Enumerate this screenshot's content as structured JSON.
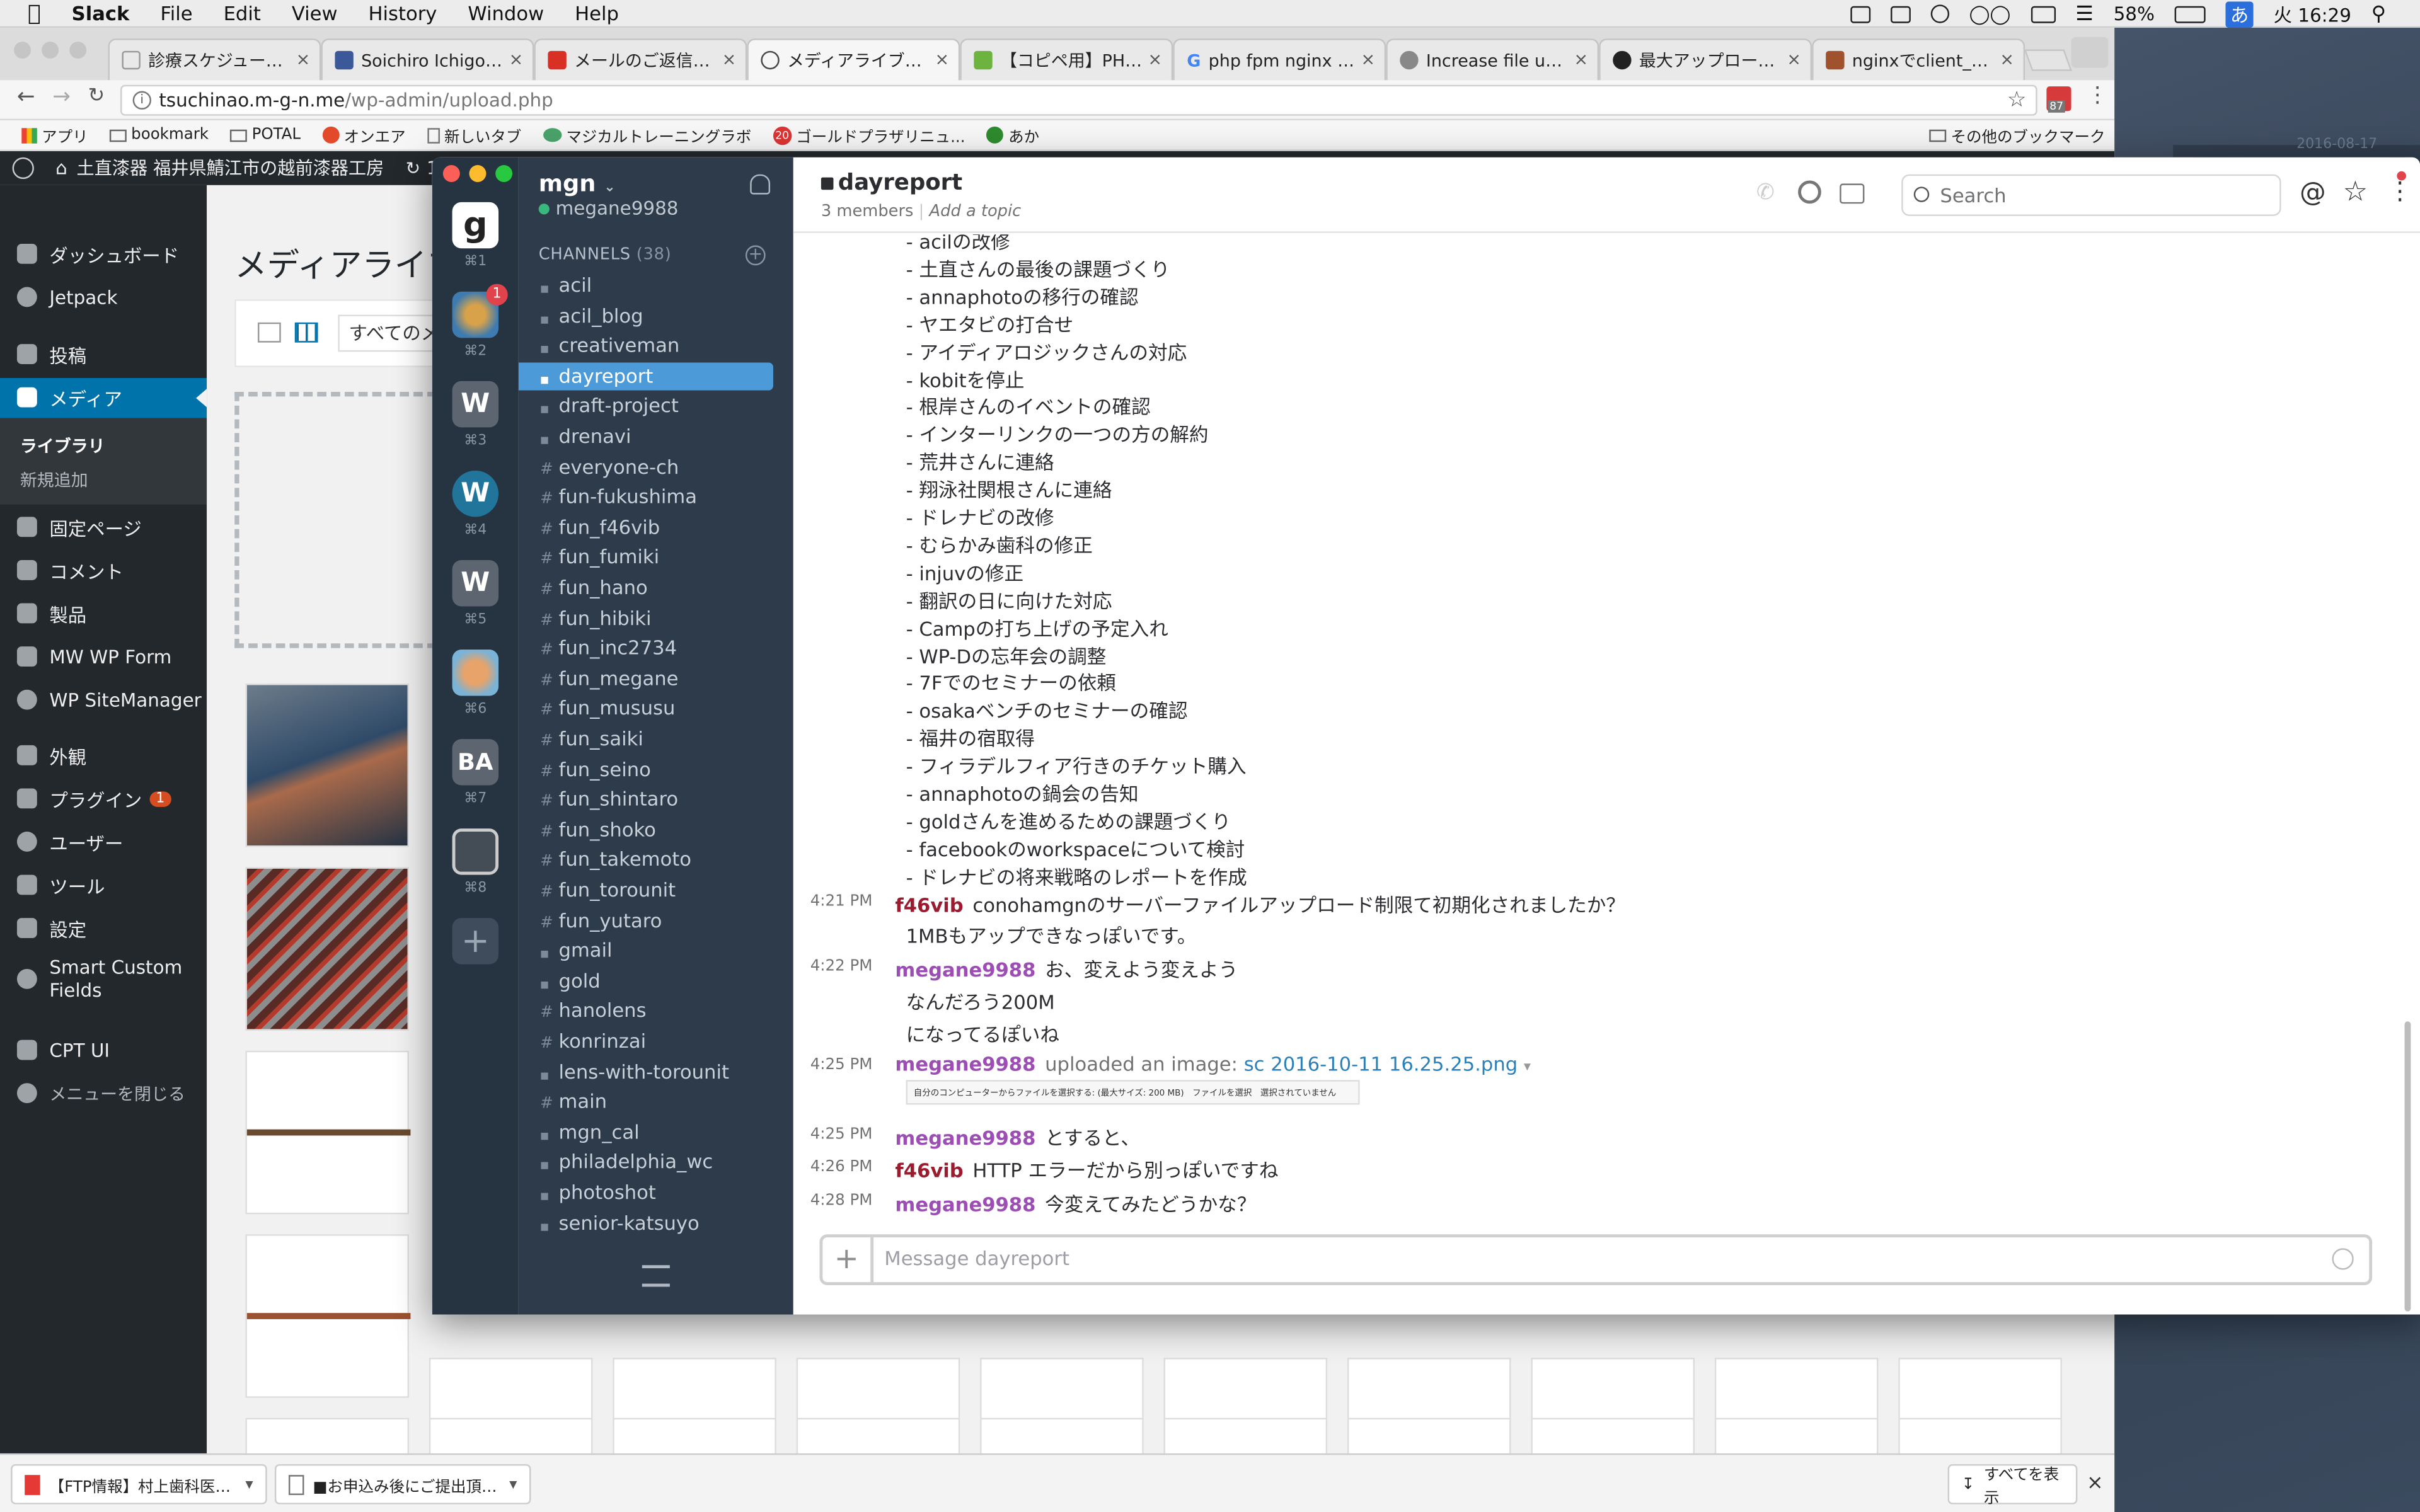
{
  "menubar": {
    "items": [
      "Slack",
      "File",
      "Edit",
      "View",
      "History",
      "Window",
      "Help"
    ],
    "battery": "58%",
    "input_method": "あ",
    "clock": "火 16:29"
  },
  "chrome": {
    "tabs": [
      {
        "label": "診療スケジュール | 村",
        "fav": "#999999"
      },
      {
        "label": "Soichiro Ichigo Tana",
        "fav": "#3b5998"
      },
      {
        "label": "メールのご返信ありが",
        "fav": "#d93025"
      },
      {
        "label": "メディアライブラリ ‹",
        "fav": "#464646"
      },
      {
        "label": "【コピペ用】PHPのア",
        "fav": "#6db33f"
      },
      {
        "label": "php fpm nginx maxu",
        "fav": "#4285f4"
      },
      {
        "label": "Increase file upload",
        "fav": "#888888"
      },
      {
        "label": "最大アップロード容量",
        "fav": "#222222"
      },
      {
        "label": "nginxでclient_max_b",
        "fav": "#a0522d"
      }
    ],
    "url_host": "tsuchinao.m-g-n.me",
    "url_path": "/wp-admin/upload.php",
    "ext_badge": "87",
    "bookmarks": [
      "アプリ",
      "bookmark",
      "POTAL",
      "オンエア",
      "新しいタブ",
      "マジカルトレーニングラボ",
      "ゴールドプラザリニュ...",
      "あか"
    ],
    "bookmark_badge": "20",
    "other_bookmarks": "その他のブックマーク",
    "downloads": [
      {
        "label": "【FTP情報】村上歯科医院.pdf"
      },
      {
        "label": "■お申込み後にご提出頂....xlsx"
      }
    ],
    "show_all": "すべてを表示"
  },
  "wordpress": {
    "site_name": "土直漆器 福井県鯖江市の越前漆器工房",
    "updates": "1",
    "menu": [
      {
        "label": "ダッシュボード"
      },
      {
        "label": "Jetpack"
      },
      {
        "label": "投稿"
      },
      {
        "label": "メディア"
      },
      {
        "label": "固定ページ"
      },
      {
        "label": "コメント"
      },
      {
        "label": "製品"
      },
      {
        "label": "MW WP Form"
      },
      {
        "label": "WP SiteManager"
      },
      {
        "label": "外観"
      },
      {
        "label": "プラグイン"
      },
      {
        "label": "ユーザー"
      },
      {
        "label": "ツール"
      },
      {
        "label": "設定"
      },
      {
        "label": "Smart Custom Fields"
      },
      {
        "label": "CPT UI"
      },
      {
        "label": "メニューを閉じる"
      }
    ],
    "submenu": [
      "ライブラリ",
      "新規追加"
    ],
    "plugin_badge": "1",
    "page_title": "メディアライブラ",
    "filter_label": "すべてのメ"
  },
  "slack": {
    "team": "mgn",
    "user": "megane9988",
    "channels_header": "CHANNELS",
    "channels_count": "(38)",
    "teams": [
      {
        "key": "⌘1",
        "letter": "g",
        "color": "#ffffff",
        "fg": "#222222"
      },
      {
        "key": "⌘2",
        "letter": "",
        "color": "#5b8fb5",
        "fg": "#ffffff",
        "badge": "1"
      },
      {
        "key": "⌘3",
        "letter": "W",
        "color": "#5d6670",
        "fg": "#ffffff"
      },
      {
        "key": "⌘4",
        "letter": "W",
        "color": "#21759b",
        "fg": "#ffffff"
      },
      {
        "key": "⌘5",
        "letter": "W",
        "color": "#5d6670",
        "fg": "#ffffff"
      },
      {
        "key": "⌘6",
        "letter": "",
        "color": "#c7a27a",
        "fg": "#ffffff"
      },
      {
        "key": "⌘7",
        "letter": "BA",
        "color": "#5d6670",
        "fg": "#ffffff"
      },
      {
        "key": "⌘8",
        "letter": "",
        "color": "#444c55",
        "fg": "#ffffff"
      }
    ],
    "channels": [
      {
        "name": "acil",
        "type": "lock"
      },
      {
        "name": "acil_blog",
        "type": "lock"
      },
      {
        "name": "creativeman",
        "type": "lock"
      },
      {
        "name": "dayreport",
        "type": "lock",
        "selected": true
      },
      {
        "name": "draft-project",
        "type": "lock"
      },
      {
        "name": "drenavi",
        "type": "lock"
      },
      {
        "name": "everyone-ch",
        "type": "hash"
      },
      {
        "name": "fun-fukushima",
        "type": "hash"
      },
      {
        "name": "fun_f46vib",
        "type": "hash"
      },
      {
        "name": "fun_fumiki",
        "type": "hash"
      },
      {
        "name": "fun_hano",
        "type": "hash"
      },
      {
        "name": "fun_hibiki",
        "type": "hash"
      },
      {
        "name": "fun_inc2734",
        "type": "hash"
      },
      {
        "name": "fun_megane",
        "type": "hash"
      },
      {
        "name": "fun_mususu",
        "type": "hash"
      },
      {
        "name": "fun_saiki",
        "type": "hash"
      },
      {
        "name": "fun_seino",
        "type": "hash"
      },
      {
        "name": "fun_shintaro",
        "type": "hash"
      },
      {
        "name": "fun_shoko",
        "type": "hash"
      },
      {
        "name": "fun_takemoto",
        "type": "hash"
      },
      {
        "name": "fun_torounit",
        "type": "hash"
      },
      {
        "name": "fun_yutaro",
        "type": "hash"
      },
      {
        "name": "gmail",
        "type": "lock"
      },
      {
        "name": "gold",
        "type": "lock"
      },
      {
        "name": "hanolens",
        "type": "hash"
      },
      {
        "name": "konrinzai",
        "type": "hash"
      },
      {
        "name": "lens-with-torounit",
        "type": "lock"
      },
      {
        "name": "main",
        "type": "hash"
      },
      {
        "name": "mgn_cal",
        "type": "lock"
      },
      {
        "name": "philadelphia_wc",
        "type": "lock"
      },
      {
        "name": "photoshot",
        "type": "lock"
      },
      {
        "name": "senior-katsuyo",
        "type": "lock"
      }
    ],
    "channel_title": "dayreport",
    "members": "3 members",
    "add_topic": "Add a topic",
    "search_placeholder": "Search",
    "list_items": [
      "- acilの改修",
      "- 土直さんの最後の課題づくり",
      "- annaphotoの移行の確認",
      "- ヤエタビの打合せ",
      "- アイディアロジックさんの対応",
      "- kobitを停止",
      "- 根岸さんのイベントの確認",
      "- インターリンクの一つの方の解約",
      "- 荒井さんに連絡",
      "- 翔泳社関根さんに連絡",
      "- ドレナビの改修",
      "- むらかみ歯科の修正",
      "- injuvの修正",
      "- 翻訳の日に向けた対応",
      "- Campの打ち上げの予定入れ",
      "- WP-Dの忘年会の調整",
      "- 7Fでのセミナーの依頼",
      "- osakaベンチのセミナーの確認",
      "- 福井の宿取得",
      "- フィラデルフィア行きのチケット購入",
      "- annaphotoの鍋会の告知",
      "- goldさんを進めるための課題づくり",
      "- facebookのworkspaceについて検討",
      "- ドレナビの将来戦略のレポートを作成"
    ],
    "messages": [
      {
        "time": "4:21 PM",
        "user": "f46vib",
        "text": "conohamgnのサーバーファイルアップロード制限て初期化されましたか？",
        "more": [
          "1MBもアップできなっぽいです。"
        ]
      },
      {
        "time": "4:22 PM",
        "user": "megane9988",
        "text": "お、変えよう変えよう",
        "more": [
          "なんだろう200M",
          "になってるぽいね"
        ]
      },
      {
        "time": "4:25 PM",
        "user": "megane9988",
        "uploaded": "uploaded an image:",
        "file": "sc 2016-10-11 16.25.25.png",
        "preview": "自分のコンピューターからファイルを選択する: (最大サイズ: 200 MB)　ファイルを選択　選択されていません"
      },
      {
        "time": "4:25 PM",
        "user": "megane9988",
        "text": "とすると、"
      },
      {
        "time": "4:26 PM",
        "user": "f46vib",
        "text": "HTTP エラーだから別っぽいですね"
      },
      {
        "time": "4:28 PM",
        "user": "megane9988",
        "text": "今変えてみたどうかな？"
      }
    ],
    "composer_placeholder": "Message dayreport"
  },
  "desktop": {
    "date_label": "2016-08-17"
  }
}
